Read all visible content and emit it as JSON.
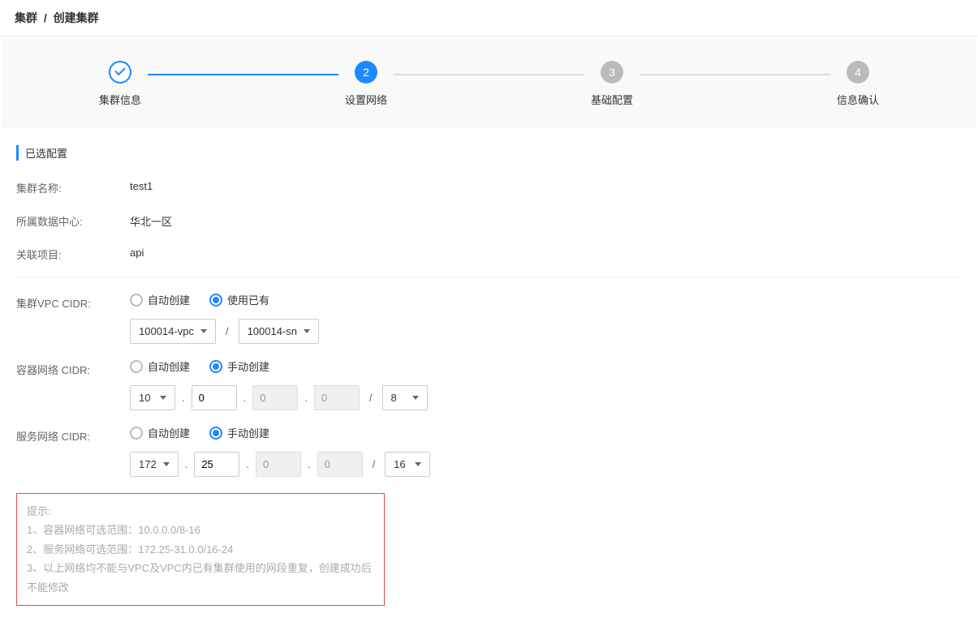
{
  "breadcrumb": {
    "parent": "集群",
    "current": "创建集群"
  },
  "steps": [
    {
      "label": "集群信息",
      "num": ""
    },
    {
      "label": "设置网络",
      "num": "2"
    },
    {
      "label": "基础配置",
      "num": "3"
    },
    {
      "label": "信息确认",
      "num": "4"
    }
  ],
  "section": {
    "title": "已选配置"
  },
  "info": {
    "name_label": "集群名称:",
    "name_value": "test1",
    "dc_label": "所属数据中心:",
    "dc_value": "华北一区",
    "proj_label": "关联项目:",
    "proj_value": "api"
  },
  "vpc": {
    "label": "集群VPC CIDR:",
    "opt_auto": "自动创建",
    "opt_exist": "使用已有",
    "vpc_select": "100014-vpc",
    "sn_select": "100014-sn"
  },
  "container": {
    "label": "容器网络 CIDR:",
    "opt_auto": "自动创建",
    "opt_manual": "手动创建",
    "oct1": "10",
    "oct2": "0",
    "oct3": "0",
    "oct4": "0",
    "mask": "8"
  },
  "service": {
    "label": "服务网络 CIDR:",
    "opt_auto": "自动创建",
    "opt_manual": "手动创建",
    "oct1": "172",
    "oct2": "25",
    "oct3": "0",
    "oct4": "0",
    "mask": "16"
  },
  "hints": {
    "title": "提示:",
    "l1": "1、容器网络可选范围：10.0.0.0/8-16",
    "l2": "2、服务网络可选范围：172.25-31.0.0/16-24",
    "l3": "3、以上网络均不能与VPC及VPC内已有集群使用的网段重复，创建成功后不能修改"
  }
}
